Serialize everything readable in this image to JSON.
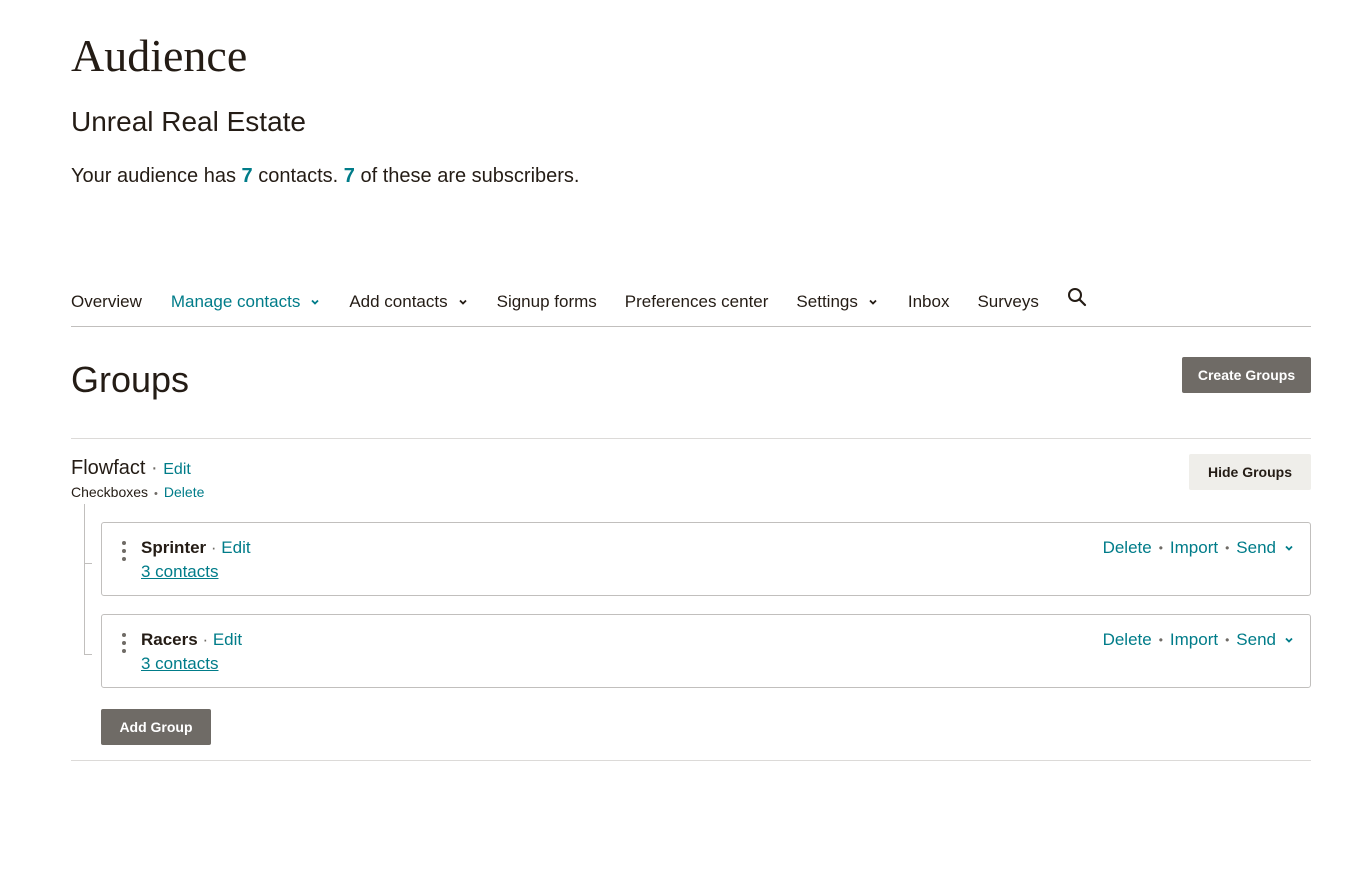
{
  "page": {
    "title": "Audience",
    "audience_name": "Unreal Real Estate",
    "summary": {
      "prefix": "Your audience has ",
      "contacts": "7",
      "middle": " contacts. ",
      "subscribers": "7",
      "suffix": " of these are subscribers."
    }
  },
  "nav": {
    "items": [
      {
        "label": "Overview"
      },
      {
        "label": "Manage contacts",
        "active": true,
        "dropdown": true
      },
      {
        "label": "Add contacts",
        "dropdown": true
      },
      {
        "label": "Signup forms"
      },
      {
        "label": "Preferences center"
      },
      {
        "label": "Settings",
        "dropdown": true
      },
      {
        "label": "Inbox"
      },
      {
        "label": "Surveys"
      }
    ],
    "search_icon": "search-icon"
  },
  "groups": {
    "title": "Groups",
    "create_label": "Create Groups",
    "category": {
      "name": "Flowfact",
      "edit_label": "Edit",
      "type": "Checkboxes",
      "delete_label": "Delete",
      "hide_label": "Hide Groups"
    },
    "items": [
      {
        "name": "Sprinter",
        "edit_label": "Edit",
        "count": "3 contacts",
        "delete_label": "Delete",
        "import_label": "Import",
        "send_label": "Send"
      },
      {
        "name": "Racers",
        "edit_label": "Edit",
        "count": "3 contacts",
        "delete_label": "Delete",
        "import_label": "Import",
        "send_label": "Send"
      }
    ],
    "add_label": "Add Group"
  },
  "colors": {
    "accent": "#007c89",
    "dark_button": "#6f6b66",
    "light_button": "#efeeea",
    "text": "#241c15"
  }
}
